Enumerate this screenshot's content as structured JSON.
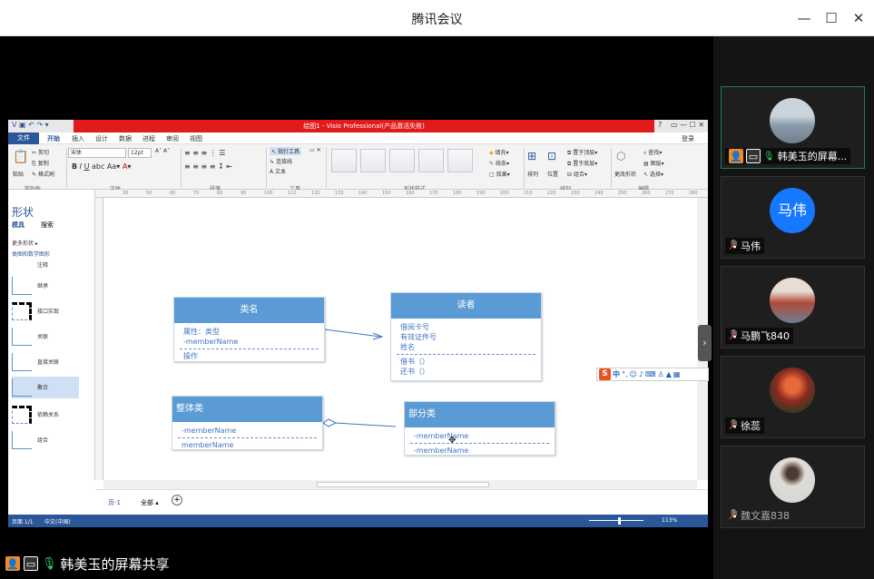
{
  "app": {
    "title": "腾讯会议"
  },
  "window_controls": {
    "minimize": "—",
    "maximize": "☐",
    "close": "✕"
  },
  "share": {
    "label": "韩美玉的屏幕共享"
  },
  "visio": {
    "title": "绘图1 - Visio Professional(产品激活失败)",
    "help": "?",
    "login": "登录",
    "tabs": [
      "文件",
      "开始",
      "插入",
      "设计",
      "数据",
      "进程",
      "审阅",
      "视图"
    ],
    "ribbon": {
      "paste": "粘贴",
      "cut": "剪切",
      "copy": "复制",
      "format_painter": "格式刷",
      "font_name": "宋体",
      "font_size": "12pt",
      "pointer_tool": "指针工具",
      "connector": "连接线",
      "text": "文本",
      "fill": "填充",
      "line": "线条",
      "effect": "效果",
      "arrange": "排列",
      "position": "位置",
      "bring_front": "置于顶层",
      "send_back": "置于底层",
      "group": "组合",
      "change_shape": "更改形状",
      "find": "查找",
      "layer": "图层",
      "select": "选择",
      "groups": [
        "剪贴板",
        "字体",
        "段落",
        "工具",
        "形状样式",
        "排列",
        "编辑"
      ]
    },
    "shapes": {
      "title": "形状",
      "tabs": [
        "模具",
        "搜索"
      ],
      "more": "更多形状",
      "category": "类图和数学图形",
      "items": [
        "注释",
        "继承",
        "接口实现",
        "关联",
        "直接关联",
        "聚合",
        "依赖关系",
        "组合"
      ]
    },
    "ruler_marks": [
      "30",
      "50",
      "60",
      "70",
      "80",
      "90",
      "100",
      "110",
      "120",
      "130",
      "140",
      "150",
      "160",
      "170",
      "180",
      "190",
      "200",
      "210",
      "220",
      "230",
      "240",
      "250",
      "260",
      "270",
      "280"
    ],
    "page_tabs": {
      "page": "页-1",
      "all": "全部",
      "add": "+"
    },
    "status": {
      "page": "页面 1/1",
      "lang": "中文(中国)",
      "zoom": "113%"
    },
    "diagram": {
      "class1": {
        "name": "类名",
        "attrs": [
          "属性：类型",
          "-memberName"
        ],
        "ops": [
          "操作"
        ]
      },
      "reader": {
        "name": "读者",
        "attrs": [
          "借阅卡号",
          "有效证件号",
          "姓名"
        ],
        "ops": [
          "借书（）",
          "还书（）"
        ]
      },
      "whole": {
        "name": "整体类",
        "attrs": [
          "-memberName",
          "memberName"
        ]
      },
      "part": {
        "name": "部分类",
        "attrs": [
          "-memberName",
          "-memberName"
        ]
      }
    }
  },
  "ime": {
    "logo": "S",
    "mode": "中"
  },
  "participants": [
    {
      "name": "韩美玉的屏幕...",
      "active": true,
      "avatar_color": "#a9b7c4"
    },
    {
      "name": "马伟",
      "active": false,
      "avatar_text": "马伟",
      "avatar_color": "#1677ff"
    },
    {
      "name": "马鹏飞840",
      "active": false,
      "avatar_color": "#b9a59a"
    },
    {
      "name": "徐蕊",
      "active": false,
      "avatar_color": "#8b2a20"
    },
    {
      "name": "魏文嘉838",
      "active": false,
      "avatar_color": "#cfd4d8"
    }
  ]
}
